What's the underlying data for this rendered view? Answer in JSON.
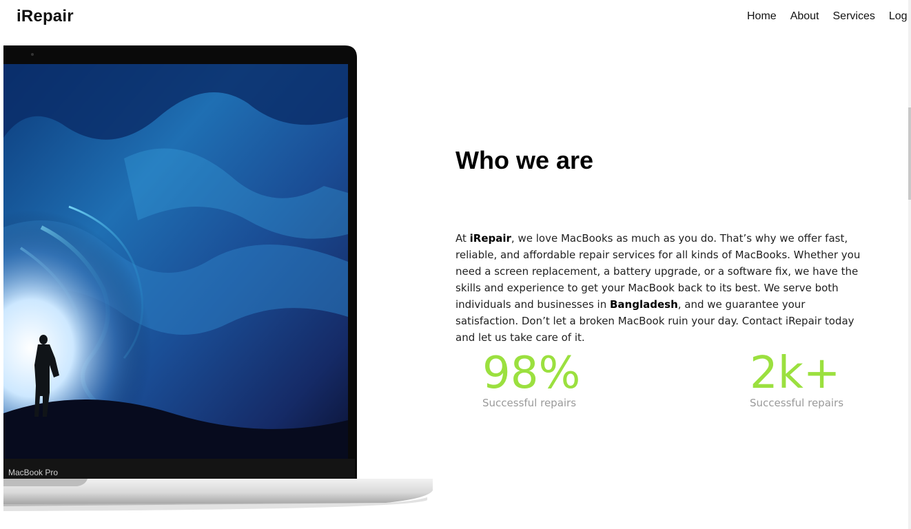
{
  "brand": "iRepair",
  "nav": {
    "items": [
      "Home",
      "About",
      "Services",
      "Log"
    ]
  },
  "hero": {
    "device_label": "MacBook Pro"
  },
  "about": {
    "heading": "Who we are",
    "paragraph": {
      "p1": "At ",
      "brand": "iRepair",
      "p2": ", we love MacBooks as much as you do. That’s why we offer fast, reliable, and affordable repair services for all kinds of MacBooks. Whether you need a screen replacement, a battery upgrade, or a software fix, we have the skills and experience to get your MacBook back to its best. We serve both individuals and businesses in ",
      "country": "Bangladesh",
      "p3": ", and we guarantee your satisfaction. Don’t let a broken MacBook ruin your day. Contact iRepair today and let us take care of it."
    }
  },
  "stats": [
    {
      "value": "98%",
      "label": "Successful repairs"
    },
    {
      "value": "2k+",
      "label": "Successful repairs"
    }
  ],
  "colors": {
    "accent": "#9be03f",
    "muted": "#9a9a9a"
  }
}
